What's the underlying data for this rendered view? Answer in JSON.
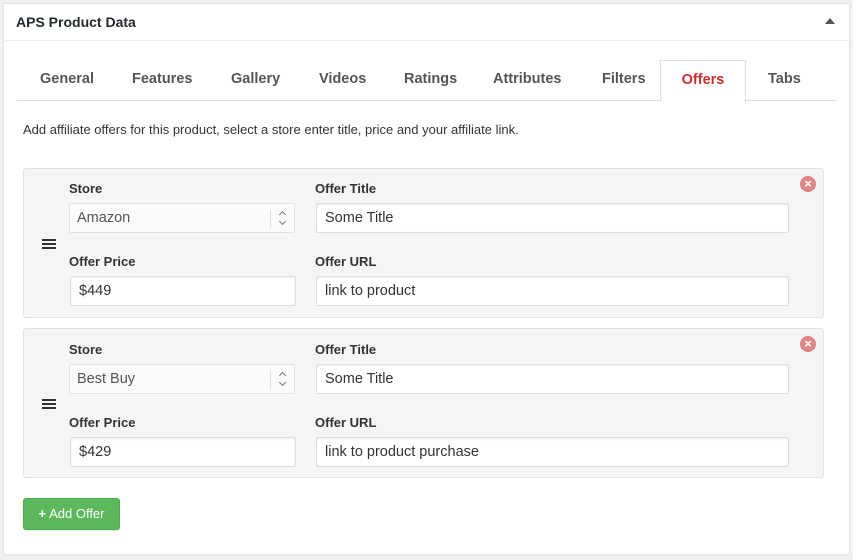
{
  "panel": {
    "title": "APS Product Data"
  },
  "tabs": [
    {
      "label": "General"
    },
    {
      "label": "Features"
    },
    {
      "label": "Gallery"
    },
    {
      "label": "Videos"
    },
    {
      "label": "Ratings"
    },
    {
      "label": "Attributes"
    },
    {
      "label": "Filters"
    },
    {
      "label": "Offers",
      "active": true
    },
    {
      "label": "Tabs"
    }
  ],
  "description": "Add affiliate offers for this product, select a store enter title, price and your affiliate link.",
  "labels": {
    "store": "Store",
    "offer_title": "Offer Title",
    "offer_price": "Offer Price",
    "offer_url": "Offer URL"
  },
  "offers": [
    {
      "store": "Amazon",
      "title": "Some Title",
      "price": "$449",
      "url": "link to product"
    },
    {
      "store": "Best Buy",
      "title": "Some Title",
      "price": "$429",
      "url": "link to product purchase"
    }
  ],
  "add_button": {
    "label": "Add Offer",
    "icon": "+"
  },
  "colors": {
    "active_tab": "#c9302c",
    "add_button": "#5cb85c",
    "remove_icon": "#e08585"
  }
}
